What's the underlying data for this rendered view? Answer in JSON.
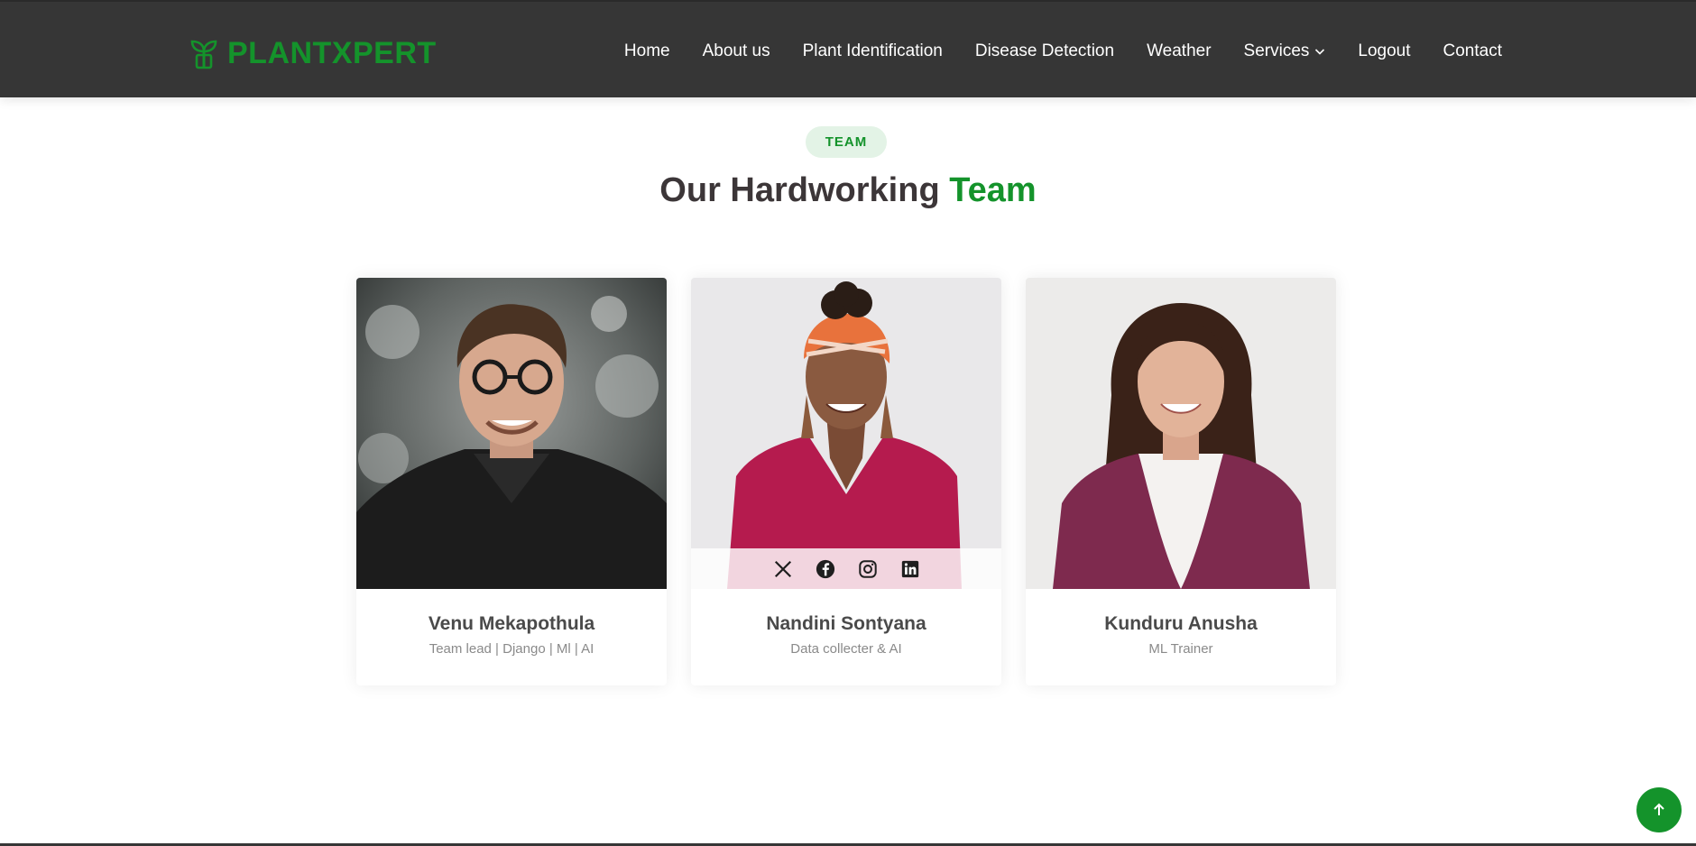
{
  "header": {
    "brand": "PLANTXPERT",
    "nav": [
      {
        "label": "Home"
      },
      {
        "label": "About us"
      },
      {
        "label": "Plant Identification"
      },
      {
        "label": "Disease Detection"
      },
      {
        "label": "Weather"
      },
      {
        "label": "Services",
        "icon": "chevron-down-icon"
      },
      {
        "label": "Logout"
      },
      {
        "label": "Contact"
      }
    ]
  },
  "section": {
    "badge": "TEAM",
    "title_prefix": "Our Hardworking",
    "title_accent": "Team"
  },
  "team": [
    {
      "name": "Venu Mekapothula",
      "role": "Team lead | Django | Ml | AI"
    },
    {
      "name": "Nandini Sontyana",
      "role": "Data collecter & AI",
      "social": [
        "x-icon",
        "facebook-icon",
        "instagram-icon",
        "linkedin-icon"
      ]
    },
    {
      "name": "Kunduru Anusha",
      "role": "ML Trainer"
    }
  ],
  "colors": {
    "accent": "#14932b",
    "header_bg": "#363636",
    "badge_bg": "#e3f3e6"
  }
}
